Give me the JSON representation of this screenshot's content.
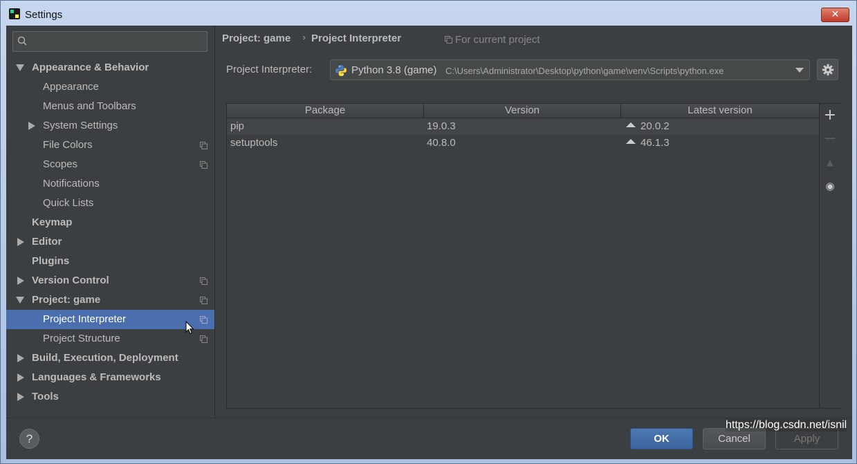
{
  "window": {
    "title": "Settings",
    "close_label": "✕"
  },
  "search": {
    "value": "",
    "placeholder": ""
  },
  "sidebar": {
    "items": [
      {
        "label": "Appearance & Behavior"
      },
      {
        "label": "Appearance"
      },
      {
        "label": "Menus and Toolbars"
      },
      {
        "label": "System Settings"
      },
      {
        "label": "File Colors"
      },
      {
        "label": "Scopes"
      },
      {
        "label": "Notifications"
      },
      {
        "label": "Quick Lists"
      },
      {
        "label": "Keymap"
      },
      {
        "label": "Editor"
      },
      {
        "label": "Plugins"
      },
      {
        "label": "Version Control"
      },
      {
        "label": "Project: game"
      },
      {
        "label": "Project Interpreter"
      },
      {
        "label": "Project Structure"
      },
      {
        "label": "Build, Execution, Deployment"
      },
      {
        "label": "Languages & Frameworks"
      },
      {
        "label": "Tools"
      }
    ]
  },
  "breadcrumb": {
    "parent": "Project: game",
    "separator": "›",
    "current": "Project Interpreter",
    "scope_note": "For current project"
  },
  "interpreter": {
    "label": "Project Interpreter:",
    "name": "Python 3.8 (game)",
    "path": "C:\\Users\\Administrator\\Desktop\\python\\game\\venv\\Scripts\\python.exe"
  },
  "packages": {
    "columns": [
      "Package",
      "Version",
      "Latest version"
    ],
    "rows": [
      {
        "package": "pip",
        "version": "19.0.3",
        "latest": "20.0.2"
      },
      {
        "package": "setuptools",
        "version": "40.8.0",
        "latest": "46.1.3"
      }
    ],
    "toolbar": {
      "add": "+",
      "remove": "−",
      "upgrade": "▲",
      "show": "◉"
    }
  },
  "footer": {
    "help": "?",
    "ok": "OK",
    "cancel": "Cancel",
    "apply": "Apply"
  },
  "watermark": "https://blog.csdn.net/isnil",
  "colors": {
    "background": "#3c3f41",
    "selection": "#4b6eaf",
    "ok_button": "#3c639d",
    "text": "#bbbbbb"
  }
}
